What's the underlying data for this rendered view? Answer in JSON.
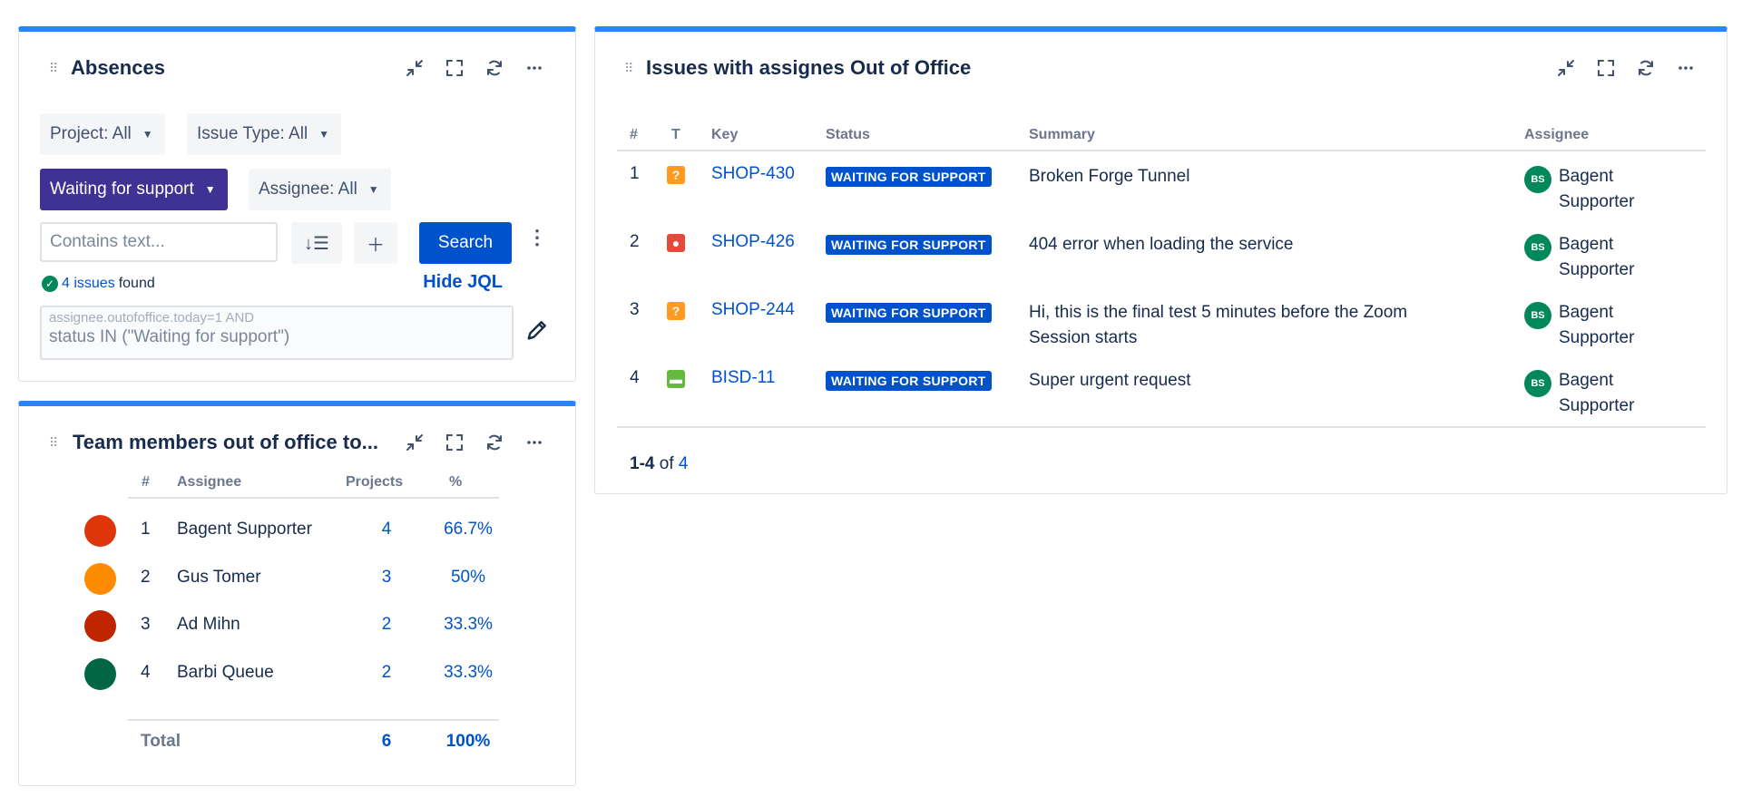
{
  "absences": {
    "title": "Absences",
    "filters": {
      "project": "Project: All",
      "issue_type": "Issue Type: All",
      "status": "Waiting for support",
      "assignee": "Assignee: All"
    },
    "search_placeholder": "Contains text...",
    "search_label": "Search",
    "found_count": "4 issues",
    "found_suffix": "found",
    "hide_jql": "Hide JQL",
    "jql_line1": "assignee.outofoffice.today=1 AND",
    "jql_line2": "status IN (\"Waiting for support\")"
  },
  "team": {
    "title": "Team members out of office to...",
    "headers": {
      "num": "#",
      "assignee": "Assignee",
      "projects": "Projects",
      "pct": "%"
    },
    "rows": [
      {
        "num": "1",
        "name": "Bagent Supporter",
        "projects": "4",
        "pct": "66.7%",
        "color": "#de350b"
      },
      {
        "num": "2",
        "name": "Gus Tomer",
        "projects": "3",
        "pct": "50%",
        "color": "#ff8b00"
      },
      {
        "num": "3",
        "name": "Ad Mihn",
        "projects": "2",
        "pct": "33.3%",
        "color": "#bf2600"
      },
      {
        "num": "4",
        "name": "Barbi Queue",
        "projects": "2",
        "pct": "33.3%",
        "color": "#006644"
      }
    ],
    "total": {
      "label": "Total",
      "projects": "6",
      "pct": "100%"
    }
  },
  "issues": {
    "title": "Issues with assignes Out of Office",
    "headers": {
      "num": "#",
      "type": "T",
      "key": "Key",
      "status": "Status",
      "summary": "Summary",
      "assignee": "Assignee"
    },
    "rows": [
      {
        "num": "1",
        "type_icon": "question-icon",
        "type_color": "#ff991f",
        "key": "SHOP-430",
        "status": "WAITING FOR SUPPORT",
        "summary_1": "Broken Forge Tunnel",
        "summary_2": "",
        "avatar": "BS",
        "assignee_1": "Bagent",
        "assignee_2": "Supporter"
      },
      {
        "num": "2",
        "type_icon": "bug-icon",
        "type_color": "#e5493a",
        "key": "SHOP-426",
        "status": "WAITING FOR SUPPORT",
        "summary_1": "404 error when loading the service",
        "summary_2": "",
        "avatar": "BS",
        "assignee_1": "Bagent",
        "assignee_2": "Supporter"
      },
      {
        "num": "3",
        "type_icon": "question-icon",
        "type_color": "#ff991f",
        "key": "SHOP-244",
        "status": "WAITING FOR SUPPORT",
        "summary_1": "Hi, this is the final test 5 minutes before the Zoom",
        "summary_2": "Session starts",
        "avatar": "BS",
        "assignee_1": "Bagent",
        "assignee_2": "Supporter"
      },
      {
        "num": "4",
        "type_icon": "chat-icon",
        "type_color": "#63ba3c",
        "key": "BISD-11",
        "status": "WAITING FOR SUPPORT",
        "summary_1": "Super urgent request",
        "summary_2": "",
        "avatar": "BS",
        "assignee_1": "Bagent",
        "assignee_2": "Supporter"
      }
    ],
    "pager_range": "1-4",
    "pager_of": "of",
    "pager_total": "4"
  }
}
